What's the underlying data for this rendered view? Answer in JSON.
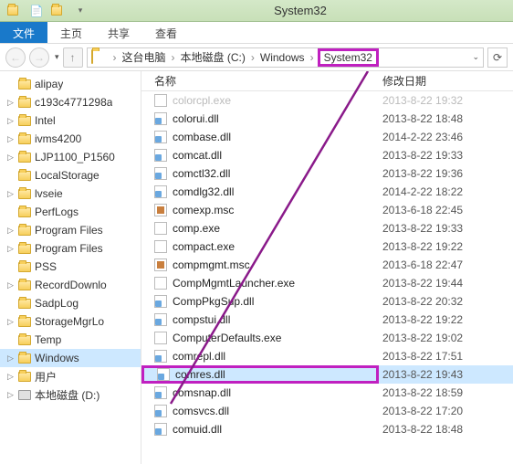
{
  "window": {
    "title": "System32"
  },
  "ribbon": {
    "file": "文件",
    "tabs": [
      "主页",
      "共享",
      "查看"
    ]
  },
  "breadcrumb": {
    "items": [
      "这台电脑",
      "本地磁盘 (C:)",
      "Windows",
      "System32"
    ]
  },
  "columns": {
    "name": "名称",
    "date": "修改日期"
  },
  "sidebar": {
    "items": [
      {
        "label": "alipay",
        "expander": ""
      },
      {
        "label": "c193c4771298a",
        "expander": "▷"
      },
      {
        "label": "Intel",
        "expander": "▷"
      },
      {
        "label": "ivms4200",
        "expander": "▷"
      },
      {
        "label": "LJP1100_P1560",
        "expander": "▷"
      },
      {
        "label": "LocalStorage",
        "expander": ""
      },
      {
        "label": "lvseie",
        "expander": "▷"
      },
      {
        "label": "PerfLogs",
        "expander": ""
      },
      {
        "label": "Program Files",
        "expander": "▷"
      },
      {
        "label": "Program Files",
        "expander": "▷"
      },
      {
        "label": "PSS",
        "expander": ""
      },
      {
        "label": "RecordDownlo",
        "expander": "▷"
      },
      {
        "label": "SadpLog",
        "expander": ""
      },
      {
        "label": "StorageMgrLo",
        "expander": "▷"
      },
      {
        "label": "Temp",
        "expander": ""
      },
      {
        "label": "Windows",
        "expander": "▷",
        "selected": true
      },
      {
        "label": "用户",
        "expander": "▷"
      },
      {
        "label": "本地磁盘 (D:)",
        "expander": "▷",
        "drive": true
      }
    ]
  },
  "files": [
    {
      "name": "colorcpl.exe",
      "date": "2013-8-22 19:32",
      "type": "exe",
      "faded": true
    },
    {
      "name": "colorui.dll",
      "date": "2013-8-22 18:48",
      "type": "dll"
    },
    {
      "name": "combase.dll",
      "date": "2014-2-22 23:46",
      "type": "dll"
    },
    {
      "name": "comcat.dll",
      "date": "2013-8-22 19:33",
      "type": "dll"
    },
    {
      "name": "comctl32.dll",
      "date": "2013-8-22 19:36",
      "type": "dll"
    },
    {
      "name": "comdlg32.dll",
      "date": "2014-2-22 18:22",
      "type": "dll"
    },
    {
      "name": "comexp.msc",
      "date": "2013-6-18 22:45",
      "type": "msc"
    },
    {
      "name": "comp.exe",
      "date": "2013-8-22 19:33",
      "type": "exe"
    },
    {
      "name": "compact.exe",
      "date": "2013-8-22 19:22",
      "type": "exe"
    },
    {
      "name": "compmgmt.msc",
      "date": "2013-6-18 22:47",
      "type": "msc"
    },
    {
      "name": "CompMgmtLauncher.exe",
      "date": "2013-8-22 19:44",
      "type": "exe"
    },
    {
      "name": "CompPkgSup.dll",
      "date": "2013-8-22 20:32",
      "type": "dll"
    },
    {
      "name": "compstui.dll",
      "date": "2013-8-22 19:22",
      "type": "dll"
    },
    {
      "name": "ComputerDefaults.exe",
      "date": "2013-8-22 19:02",
      "type": "exe"
    },
    {
      "name": "comrepl.dll",
      "date": "2013-8-22 17:51",
      "type": "dll"
    },
    {
      "name": "comres.dll",
      "date": "2013-8-22 19:43",
      "type": "dll",
      "selected": true,
      "highlight": true
    },
    {
      "name": "comsnap.dll",
      "date": "2013-8-22 18:59",
      "type": "dll"
    },
    {
      "name": "comsvcs.dll",
      "date": "2013-8-22 17:20",
      "type": "dll"
    },
    {
      "name": "comuid.dll",
      "date": "2013-8-22 18:48",
      "type": "dll"
    }
  ]
}
